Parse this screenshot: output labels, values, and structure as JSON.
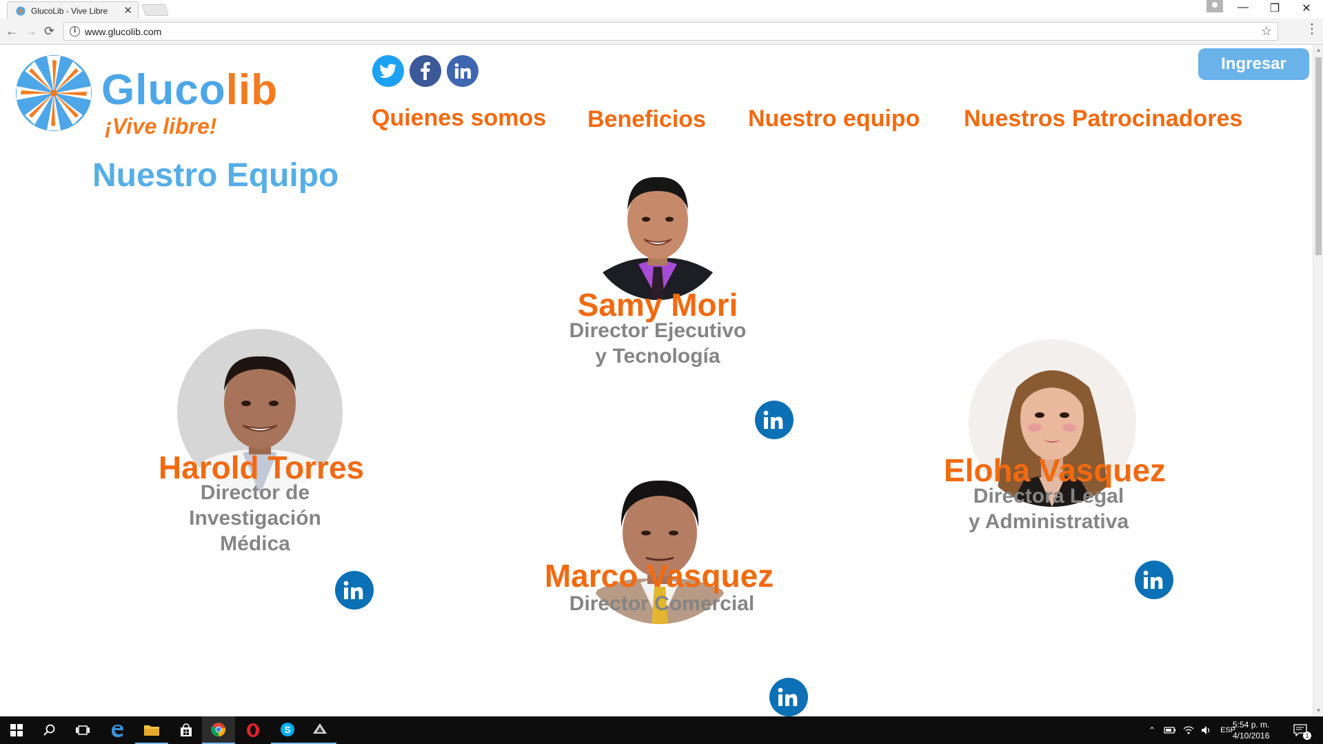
{
  "browser": {
    "tab_title": "GlucoLib - Vive Libre",
    "tab_close": "✕",
    "url": "www.glucolib.com",
    "window_minimize": "—",
    "window_restore": "❐",
    "window_close": "✕",
    "back": "←",
    "forward": "→",
    "reload": "⟳",
    "info": "i",
    "star": "☆",
    "menu": "⋮"
  },
  "site": {
    "logo_word_main": "Gluco",
    "logo_word_accent": "lib",
    "tagline": "¡Vive libre!",
    "login_label": "Ingresar",
    "social": [
      "twitter-icon",
      "facebook-icon",
      "linkedin-icon"
    ],
    "nav": [
      {
        "label": "Quienes somos"
      },
      {
        "label": "Beneficios"
      },
      {
        "label": "Nuestro equipo"
      },
      {
        "label": "Nuestros Patrocinadores"
      }
    ],
    "section_title": "Nuestro Equipo"
  },
  "team": [
    {
      "name": "Samy Mori",
      "role_line1": "Director Ejecutivo",
      "role_line2": "y Tecnología",
      "role_line3": ""
    },
    {
      "name": "Harold Torres",
      "role_line1": "Director de",
      "role_line2": "Investigación",
      "role_line3": "Médica"
    },
    {
      "name": "Eloha Vasquez",
      "role_line1": "Directora Legal",
      "role_line2": "y Administrativa",
      "role_line3": ""
    },
    {
      "name": "Marco Vasquez",
      "role_line1": "Director Comercial",
      "role_line2": "",
      "role_line3": ""
    }
  ],
  "linkedin_badge": "in",
  "taskbar": {
    "language": "ESP",
    "time": "5:54 p. m.",
    "date": "4/10/2016",
    "notification_count": "1",
    "tray_caret": "⌃"
  },
  "colors": {
    "brand_blue": "#4da6e8",
    "brand_orange": "#f26a10",
    "role_gray": "#858585",
    "linkedin_blue": "#0b70b5"
  }
}
